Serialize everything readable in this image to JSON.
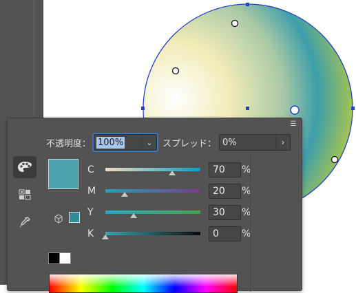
{
  "panel": {
    "opacity_label": "不透明度：",
    "opacity_value": "100%",
    "spread_label": "スプレッド：",
    "spread_value": "0%",
    "spread_arrow": "›",
    "dropdown_arrow": "⌄"
  },
  "sliders": [
    {
      "channel": "C",
      "value": "70",
      "unit": "%",
      "fraction": 0.7
    },
    {
      "channel": "M",
      "value": "20",
      "unit": "%",
      "fraction": 0.2
    },
    {
      "channel": "Y",
      "value": "30",
      "unit": "%",
      "fraction": 0.3
    },
    {
      "channel": "K",
      "value": "0",
      "unit": "%",
      "fraction": 0.0
    }
  ],
  "colors": {
    "fill_swatch": "#4ba0ac",
    "gamut_swatch": "#2f8c97",
    "selection_blue": "#2443c8",
    "artboard_edge": "#c4373c"
  },
  "icons": {
    "panel_menu": "hamburger-icon",
    "tools": [
      "palette-icon",
      "swatch-grid-icon",
      "eyedropper-icon"
    ],
    "gamut": "cube-icon"
  }
}
